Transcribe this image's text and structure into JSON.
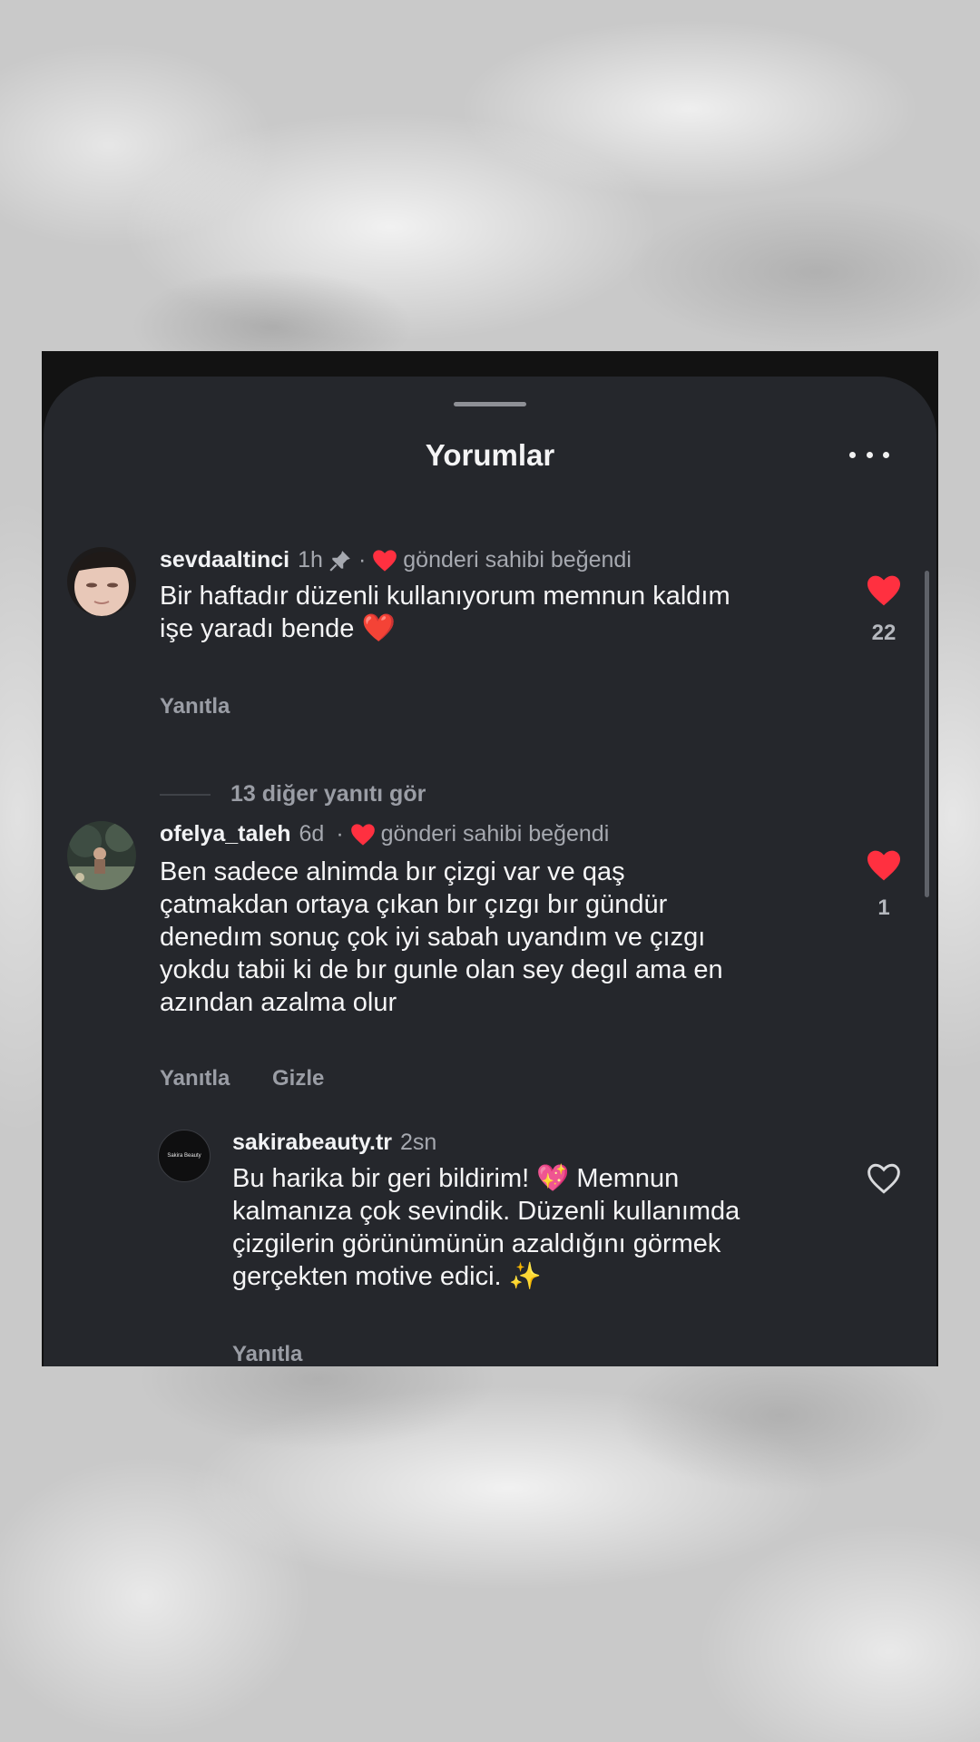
{
  "sheet": {
    "title": "Yorumlar",
    "more_icon": "more-horizontal-icon"
  },
  "comments": [
    {
      "username": "sevdaaltinci",
      "time": "1h",
      "pinned": true,
      "owner_liked_label": "gönderi sahibi beğendi",
      "text_line1": "Bir haftadır düzenli kullanıyorum memnun kaldım",
      "text_line2": "işe yaradı bende",
      "emoji": "❤️",
      "like_count": "22",
      "liked": true,
      "reply_label": "Yanıtla",
      "view_replies_label": "13 diğer yanıtı gör"
    },
    {
      "username": "ofelya_taleh",
      "time": "6d",
      "owner_liked_label": "gönderi sahibi beğendi",
      "text_lines": [
        "Ben sadece alnimda bır çizgi var ve qaş",
        "çatmakdan ortaya çıkan bır çızgı bır gündür",
        "denedım sonuç çok iyi sabah uyandım ve çızgı",
        "yokdu tabii ki de bır gunle olan sey degıl ama en",
        "azından azalma olur"
      ],
      "like_count": "1",
      "liked": true,
      "reply_label": "Yanıtla",
      "hide_label": "Gizle"
    },
    {
      "username": "sakirabeauty.tr",
      "time": "2sn",
      "avatar_text": "Sakira Beauty",
      "text_line1": "Bu harika bir geri bildirim!",
      "emoji1": "💖",
      "text_line1_end": "Memnun",
      "text_lines": [
        "kalmanıza çok sevindik. Düzenli kullanımda",
        "çizgilerin görünümünün azaldığını görmek"
      ],
      "text_line_last": "gerçekten motive edici.",
      "emoji2": "✨",
      "liked": false,
      "reply_label": "Yanıtla"
    }
  ],
  "colors": {
    "sheet_bg": "#25272c",
    "like_red": "#ff3040",
    "muted_text": "#a6a9b0"
  }
}
